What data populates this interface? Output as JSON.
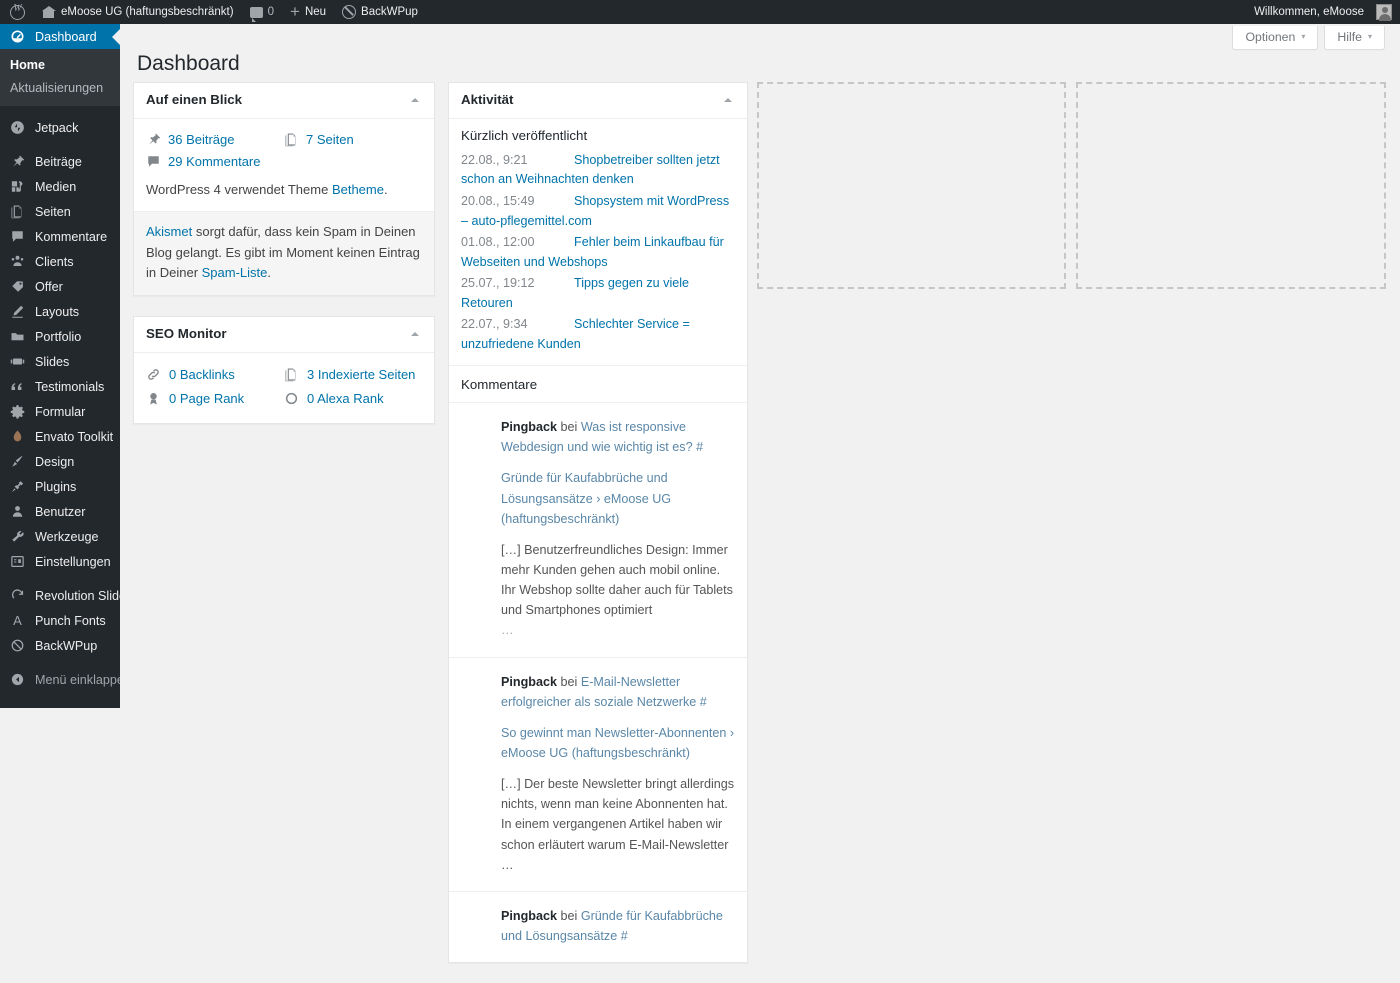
{
  "adminbar": {
    "site_name": "eMoose UG (haftungsbeschränkt)",
    "comments_count": "0",
    "new_label": "Neu",
    "backwpup_label": "BackWPup",
    "greeting": "Willkommen, eMoose"
  },
  "sidebar": {
    "items": [
      {
        "label": "Dashboard",
        "icon": "dashboard-icon",
        "current": true
      },
      {
        "label": "Jetpack",
        "icon": "jetpack-icon",
        "sep": true
      },
      {
        "label": "Beiträge",
        "icon": "pin-icon",
        "sep": true
      },
      {
        "label": "Medien",
        "icon": "media-icon"
      },
      {
        "label": "Seiten",
        "icon": "pages-icon"
      },
      {
        "label": "Kommentare",
        "icon": "comment-icon"
      },
      {
        "label": "Clients",
        "icon": "users-icon"
      },
      {
        "label": "Offer",
        "icon": "tag-icon"
      },
      {
        "label": "Layouts",
        "icon": "pencil-icon"
      },
      {
        "label": "Portfolio",
        "icon": "portfolio-icon"
      },
      {
        "label": "Slides",
        "icon": "slides-icon"
      },
      {
        "label": "Testimonials",
        "icon": "quote-icon"
      },
      {
        "label": "Formular",
        "icon": "gear-icon"
      },
      {
        "label": "Envato Toolkit",
        "icon": "envato-icon"
      },
      {
        "label": "Design",
        "icon": "brush-icon"
      },
      {
        "label": "Plugins",
        "icon": "plug-icon"
      },
      {
        "label": "Benutzer",
        "icon": "user-icon"
      },
      {
        "label": "Werkzeuge",
        "icon": "wrench-icon"
      },
      {
        "label": "Einstellungen",
        "icon": "settings-icon"
      },
      {
        "label": "Revolution Slider",
        "icon": "revslider-icon",
        "sep": true
      },
      {
        "label": "Punch Fonts",
        "icon": "font-icon"
      },
      {
        "label": "BackWPup",
        "icon": "backwpup-icon"
      }
    ],
    "submenu": [
      {
        "label": "Home",
        "active": true
      },
      {
        "label": "Aktualisierungen",
        "active": false
      }
    ],
    "collapse_label": "Menü einklappen"
  },
  "screen_meta": {
    "options_label": "Optionen",
    "help_label": "Hilfe",
    "caret": "▾"
  },
  "page": {
    "title": "Dashboard"
  },
  "widgets": {
    "at_a_glance": {
      "title": "Auf einen Blick",
      "items": [
        {
          "icon": "pin-icon",
          "label": "36 Beiträge"
        },
        {
          "icon": "pages-icon",
          "label": "7 Seiten"
        },
        {
          "icon": "comment-icon",
          "label": "29 Kommentare"
        }
      ],
      "version_note_pre": "WordPress 4 verwendet Theme ",
      "version_note_link": "Betheme",
      "version_note_post": ".",
      "akismet_link": "Akismet",
      "akismet_text_1": " sorgt dafür, dass kein Spam in Deinen Blog gelangt. Es gibt im Moment keinen Eintrag in Deiner ",
      "akismet_link_2": "Spam-Liste",
      "akismet_text_2": "."
    },
    "seo_monitor": {
      "title": "SEO Monitor",
      "items": [
        {
          "icon": "link-icon",
          "label": "0 Backlinks"
        },
        {
          "icon": "pages-icon",
          "label": "3 Indexierte Seiten"
        },
        {
          "icon": "award-icon",
          "label": "0 Page Rank"
        },
        {
          "icon": "circle-icon",
          "label": "0 Alexa Rank"
        }
      ]
    },
    "activity": {
      "title": "Aktivität",
      "recently_published_title": "Kürzlich veröffentlicht",
      "recent_posts": [
        {
          "date": "22.08., 9:21",
          "title": "Shopbetreiber sollten jetzt schon an Weihnachten denken"
        },
        {
          "date": "20.08., 15:49",
          "title": "Shopsystem mit WordPress – auto-pflegemittel.com"
        },
        {
          "date": "01.08., 12:00",
          "title": "Fehler beim Linkaufbau für Webseiten und Webshops"
        },
        {
          "date": "25.07., 19:12",
          "title": "Tipps gegen zu viele Retouren"
        },
        {
          "date": "22.07., 9:34",
          "title": "Schlechter Service = unzufriedene Kunden"
        }
      ],
      "comments_title": "Kommentare",
      "comments": [
        {
          "type": "Pingback",
          "bei": " bei ",
          "target": "Was ist responsive Webdesign und wie wichtig ist es? #",
          "excerpt_title": "Gründe für Kaufabbrüche und Lösungsansätze › eMoose UG (haftungsbeschränkt)",
          "excerpt": "[…] Benutzerfreundliches Design: Immer mehr Kunden gehen auch mobil online. Ihr Webshop sollte daher auch für Tablets und Smartphones optimiert",
          "ellipsis": "…"
        },
        {
          "type": "Pingback",
          "bei": " bei ",
          "target": "E-Mail-Newsletter erfolgreicher als soziale Netzwerke #",
          "excerpt_title": "So gewinnt man Newsletter-Abonnenten › eMoose UG (haftungsbeschränkt)",
          "excerpt": "[…] Der beste Newsletter bringt allerdings nichts, wenn man keine Abonnenten hat. In einem vergangenen Artikel haben wir schon erläutert warum E-Mail-Newsletter …",
          "ellipsis": ""
        },
        {
          "type": "Pingback",
          "bei": " bei ",
          "target": "Gründe für Kaufabbrüche und Lösungsansätze #",
          "excerpt_title": "",
          "excerpt": "",
          "ellipsis": ""
        }
      ]
    }
  },
  "colors": {
    "accent": "#0073aa",
    "admin_bg": "#23282d",
    "submenu_bg": "#32373c",
    "link": "#0073aa",
    "comment_link": "#5a87a8",
    "page_bg": "#f1f1f1"
  }
}
